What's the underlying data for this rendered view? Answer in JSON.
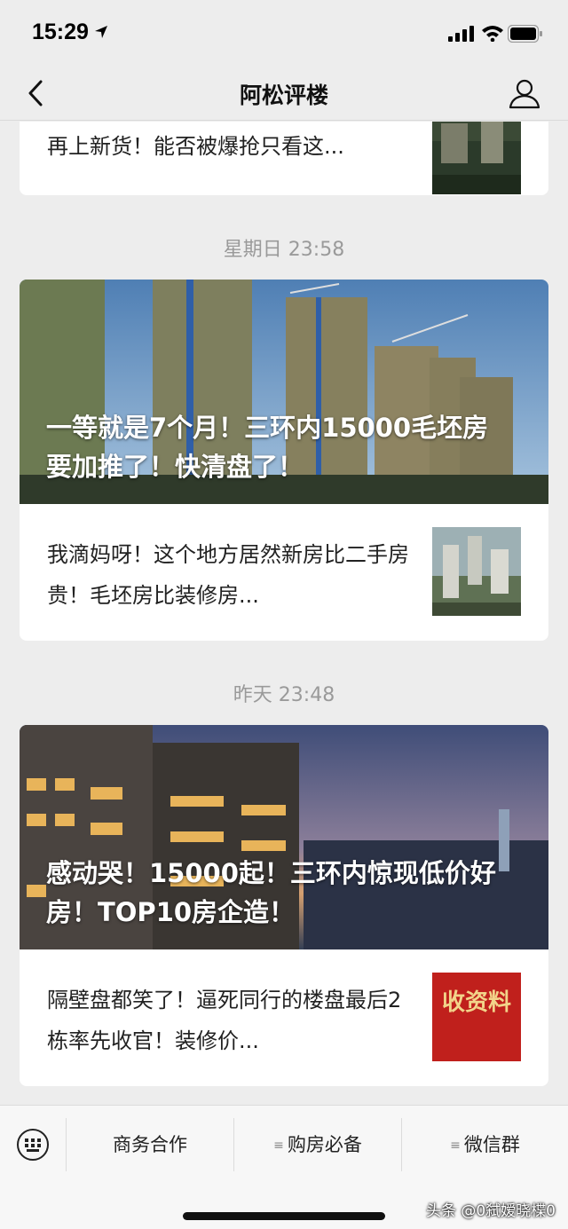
{
  "status_bar": {
    "time": "15:29"
  },
  "nav": {
    "title": "阿松评楼"
  },
  "feed": {
    "top_card": {
      "text": "再上新货！能否被爆抢只看这..."
    },
    "groups": [
      {
        "timestamp": "星期日 23:58",
        "hero_title": "一等就是7个月！三环内15000毛坯房要加推了！快清盘了！",
        "item_text": "我滴妈呀！这个地方居然新房比二手房贵！毛坯房比装修房..."
      },
      {
        "timestamp": "昨天 23:48",
        "hero_title": "感动哭！15000起！三环内惊现低价好房！TOP10房企造！",
        "item_text": "隔壁盘都笑了！逼死同行的楼盘最后2栋率先收官！装修价...",
        "thumb_text": "收资料"
      }
    ]
  },
  "menu": {
    "items": [
      "商务合作",
      "购房必备",
      "微信群"
    ]
  },
  "watermark": "头条 @0弑嫒晓楪0",
  "colors": {
    "background": "#ededed",
    "card": "#ffffff",
    "timestamp": "#9a9a9a",
    "thumb_red": "#c0201c"
  },
  "icons": [
    "location-arrow-icon",
    "signal-icon",
    "wifi-icon",
    "battery-icon",
    "back-chevron-icon",
    "profile-icon",
    "keyboard-icon",
    "menu-lines-icon"
  ]
}
